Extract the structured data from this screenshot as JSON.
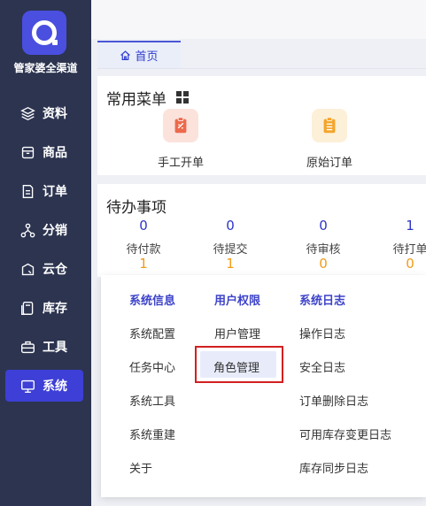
{
  "sidebar": {
    "brand": "管家婆全渠道",
    "items": [
      {
        "label": "资料",
        "icon": "layers-icon"
      },
      {
        "label": "商品",
        "icon": "box-icon"
      },
      {
        "label": "订单",
        "icon": "document-icon"
      },
      {
        "label": "分销",
        "icon": "network-icon"
      },
      {
        "label": "云仓",
        "icon": "cloud-warehouse-icon"
      },
      {
        "label": "库存",
        "icon": "inventory-icon"
      },
      {
        "label": "工具",
        "icon": "toolbox-icon"
      },
      {
        "label": "系统",
        "icon": "monitor-icon",
        "active": true
      }
    ]
  },
  "tabs": [
    {
      "label": "首页",
      "icon": "home-icon",
      "active": true
    }
  ],
  "common_menu": {
    "title": "常用菜单",
    "items": [
      {
        "label": "手工开单",
        "icon": "manual-order-icon",
        "color": "#fbe3dc",
        "icon_color": "#ec6a4c"
      },
      {
        "label": "原始订单",
        "icon": "original-order-icon",
        "color": "#fdf0d8",
        "icon_color": "#f4a52b"
      }
    ]
  },
  "todo": {
    "title": "待办事项",
    "items": [
      {
        "label": "待付款",
        "count": "0",
        "sub": "1"
      },
      {
        "label": "待提交",
        "count": "0",
        "sub": "1"
      },
      {
        "label": "待审核",
        "count": "0",
        "sub": "0"
      },
      {
        "label": "待打单",
        "count": "1",
        "sub": "0"
      }
    ]
  },
  "system_menu": {
    "columns": [
      {
        "header": "系统信息",
        "items": [
          "系统配置",
          "任务中心",
          "系统工具",
          "系统重建",
          "关于"
        ]
      },
      {
        "header": "用户权限",
        "items": [
          "用户管理",
          "角色管理"
        ]
      },
      {
        "header": "系统日志",
        "items": [
          "操作日志",
          "安全日志",
          "订单删除日志",
          "可用库存变更日志",
          "库存同步日志"
        ]
      }
    ],
    "highlighted": "角色管理"
  },
  "colors": {
    "sidebar_bg": "#2c3450",
    "accent": "#3d3fd6",
    "highlight_frame": "#d32020"
  }
}
